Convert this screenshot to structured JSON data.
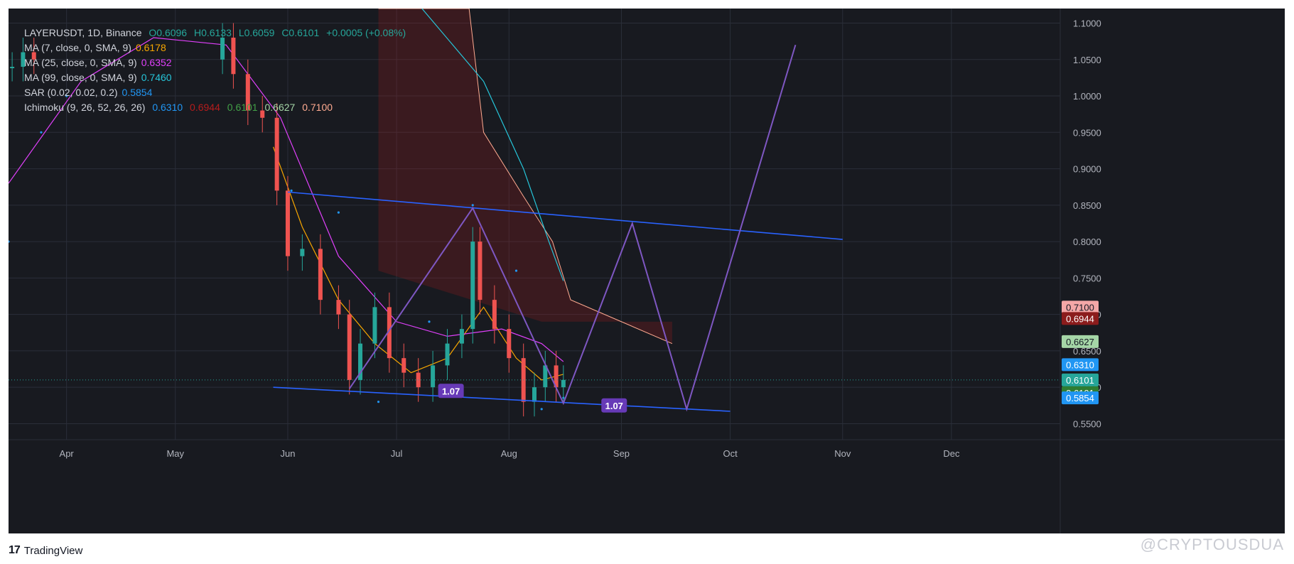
{
  "legend": {
    "header": {
      "symbol": "LAYERUSDT, 1D, Binance",
      "open": "O0.6096",
      "high": "H0.6133",
      "low": "L0.6059",
      "close": "C0.6101",
      "change": "+0.0005 (+0.08%)"
    },
    "indicators": [
      {
        "label": "MA (7, close, 0, SMA, 9)",
        "value": "0.6178",
        "color": "#f7a600"
      },
      {
        "label": "MA (25, close, 0, SMA, 9)",
        "value": "0.6352",
        "color": "#e040fb"
      },
      {
        "label": "MA (99, close, 0, SMA, 9)",
        "value": "0.7460",
        "color": "#26c6da"
      },
      {
        "label": "SAR (0.02, 0.02, 0.2)",
        "value": "0.5854",
        "color": "#2196f3"
      }
    ],
    "ichimoku": {
      "label": "Ichimoku (9, 26, 52, 26, 26)",
      "values": [
        {
          "v": "0.6310",
          "color": "#2196f3"
        },
        {
          "v": "0.6944",
          "color": "#b71c1c"
        },
        {
          "v": "0.6101",
          "color": "#43a047"
        },
        {
          "v": "0.6627",
          "color": "#a5d6a7"
        },
        {
          "v": "0.7100",
          "color": "#ffab91"
        }
      ]
    }
  },
  "price_badges": [
    {
      "value": "0.7100",
      "bg": "#f4a7a7",
      "fg": "#131722"
    },
    {
      "value": "0.6944",
      "bg": "#8b1c1c",
      "fg": "#ffffff"
    },
    {
      "value": "0.6627",
      "bg": "#a5d6a7",
      "fg": "#131722"
    },
    {
      "value": "0.6310",
      "bg": "#2196f3",
      "fg": "#ffffff"
    },
    {
      "value": "0.6101",
      "bg": "#26a69a",
      "fg": "#ffffff"
    },
    {
      "value": "0.6101",
      "bg": "#2e7d32",
      "fg": "#ffffff"
    },
    {
      "value": "0.5854",
      "bg": "#2196f3",
      "fg": "#ffffff"
    }
  ],
  "pattern_labels": [
    "1.07",
    "1.07"
  ],
  "chart_data": {
    "type": "line",
    "title": "LAYERUSDT, 1D, Binance",
    "xlabel": "",
    "ylabel": "",
    "x_ticks": [
      "Apr",
      "May",
      "Jun",
      "Jul",
      "Aug",
      "Sep",
      "Oct",
      "Nov",
      "Dec"
    ],
    "y_ticks": [
      1.1,
      1.05,
      1.0,
      0.95,
      0.9,
      0.85,
      0.8,
      0.75,
      0.7,
      0.65,
      0.6,
      0.55
    ],
    "y_tick_labels": [
      "1.1000",
      "1.0500",
      "1.0000",
      "0.9500",
      "0.9000",
      "0.8500",
      "0.8000",
      "0.7500",
      "0.7000",
      "0.6500",
      "0.6000",
      "0.5500"
    ],
    "ylim": [
      0.528,
      1.12
    ],
    "xlim": [
      "2024-03-16",
      "2024-12-31"
    ],
    "grid": true,
    "last_price": 0.6101,
    "candles_close_approx": [
      [
        "2024-03-17",
        1.04
      ],
      [
        "2024-03-20",
        1.06
      ],
      [
        "2024-03-23",
        1.05
      ],
      [
        "2024-05-14",
        1.08
      ],
      [
        "2024-05-17",
        1.03
      ],
      [
        "2024-05-21",
        0.98
      ],
      [
        "2024-05-25",
        0.97
      ],
      [
        "2024-05-29",
        0.87
      ],
      [
        "2024-06-01",
        0.78
      ],
      [
        "2024-06-05",
        0.79
      ],
      [
        "2024-06-10",
        0.72
      ],
      [
        "2024-06-15",
        0.7
      ],
      [
        "2024-06-18",
        0.61
      ],
      [
        "2024-06-21",
        0.66
      ],
      [
        "2024-06-25",
        0.71
      ],
      [
        "2024-06-29",
        0.64
      ],
      [
        "2024-07-03",
        0.62
      ],
      [
        "2024-07-07",
        0.6
      ],
      [
        "2024-07-11",
        0.63
      ],
      [
        "2024-07-15",
        0.66
      ],
      [
        "2024-07-19",
        0.68
      ],
      [
        "2024-07-22",
        0.8
      ],
      [
        "2024-07-24",
        0.72
      ],
      [
        "2024-07-28",
        0.68
      ],
      [
        "2024-08-01",
        0.64
      ],
      [
        "2024-08-05",
        0.58
      ],
      [
        "2024-08-08",
        0.6
      ],
      [
        "2024-08-11",
        0.63
      ],
      [
        "2024-08-14",
        0.6
      ],
      [
        "2024-08-16",
        0.6101
      ]
    ],
    "series": [
      {
        "name": "MA (7, close, 0, SMA, 9)",
        "color": "#f7a600",
        "points": [
          [
            "2024-05-28",
            0.93
          ],
          [
            "2024-06-05",
            0.82
          ],
          [
            "2024-06-15",
            0.72
          ],
          [
            "2024-06-25",
            0.66
          ],
          [
            "2024-07-05",
            0.62
          ],
          [
            "2024-07-15",
            0.64
          ],
          [
            "2024-07-25",
            0.71
          ],
          [
            "2024-08-03",
            0.64
          ],
          [
            "2024-08-10",
            0.61
          ],
          [
            "2024-08-16",
            0.6178
          ]
        ]
      },
      {
        "name": "MA (25, close, 0, SMA, 9)",
        "color": "#e040fb",
        "points": [
          [
            "2024-03-16",
            0.88
          ],
          [
            "2024-04-05",
            1.02
          ],
          [
            "2024-04-25",
            1.08
          ],
          [
            "2024-05-15",
            1.07
          ],
          [
            "2024-05-30",
            0.97
          ],
          [
            "2024-06-15",
            0.78
          ],
          [
            "2024-07-01",
            0.69
          ],
          [
            "2024-07-15",
            0.67
          ],
          [
            "2024-07-30",
            0.68
          ],
          [
            "2024-08-10",
            0.66
          ],
          [
            "2024-08-16",
            0.6352
          ]
        ]
      },
      {
        "name": "MA (99, close, 0, SMA, 9)",
        "color": "#26c6da",
        "points": [
          [
            "2024-07-08",
            1.12
          ],
          [
            "2024-07-25",
            1.02
          ],
          [
            "2024-08-05",
            0.9
          ],
          [
            "2024-08-12",
            0.8
          ],
          [
            "2024-08-16",
            0.746
          ]
        ]
      },
      {
        "name": "SAR (0.02, 0.02, 0.2)",
        "color": "#2196f3",
        "points": [
          [
            "2024-03-16",
            0.8
          ],
          [
            "2024-03-25",
            0.95
          ],
          [
            "2024-04-01",
            1.0
          ],
          [
            "2024-06-02",
            0.87
          ],
          [
            "2024-06-15",
            0.84
          ],
          [
            "2024-06-26",
            0.58
          ],
          [
            "2024-07-10",
            0.69
          ],
          [
            "2024-07-22",
            0.85
          ],
          [
            "2024-08-03",
            0.76
          ],
          [
            "2024-08-10",
            0.57
          ],
          [
            "2024-08-16",
            0.5854
          ]
        ]
      }
    ],
    "drawings": {
      "upper_trendline": [
        [
          "2024-06-01",
          0.868
        ],
        [
          "2024-11-01",
          0.803
        ]
      ],
      "lower_trendline": [
        [
          "2024-05-28",
          0.6
        ],
        [
          "2024-10-01",
          0.567
        ]
      ],
      "zigzag_pattern": [
        [
          "2024-06-18",
          0.598
        ],
        [
          "2024-07-22",
          0.846
        ],
        [
          "2024-08-16",
          0.578
        ],
        [
          "2024-09-04",
          0.825
        ],
        [
          "2024-09-19",
          0.57
        ],
        [
          "2024-10-19",
          1.07
        ]
      ],
      "ichimoku_cloud": [
        [
          "2024-06-26",
          1.12
        ],
        [
          "2024-07-21",
          1.12
        ],
        [
          "2024-07-25",
          0.95
        ],
        [
          "2024-08-05",
          0.862
        ],
        [
          "2024-08-13",
          0.8
        ],
        [
          "2024-08-18",
          0.72
        ],
        [
          "2024-09-01",
          0.69
        ],
        [
          "2024-09-15",
          0.66
        ]
      ]
    }
  }
}
